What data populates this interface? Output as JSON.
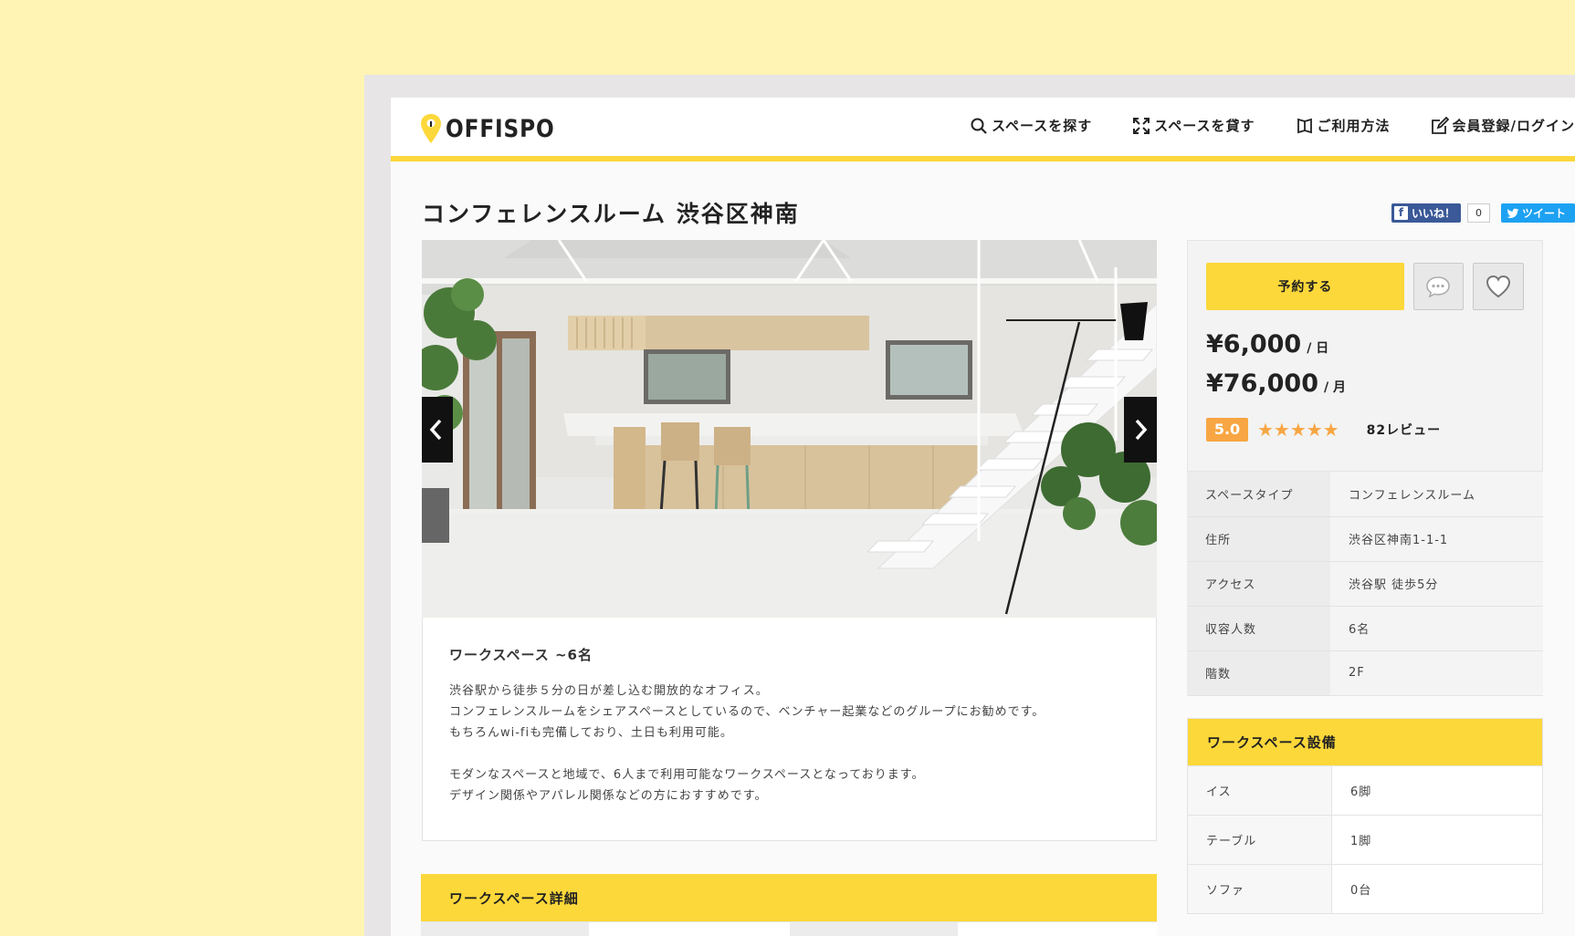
{
  "header": {
    "logo_text": "OFFISPO",
    "nav": [
      {
        "label": "スペースを探す",
        "icon": "search-icon"
      },
      {
        "label": "スペースを貸す",
        "icon": "expand-icon"
      },
      {
        "label": "ご利用方法",
        "icon": "book-icon"
      },
      {
        "label": "会員登録/ログイン",
        "icon": "edit-icon"
      }
    ]
  },
  "title": "コンフェレンスルーム 渋谷区神南",
  "social": {
    "fb_label": "いいね！",
    "fb_count": "0",
    "tweet_label": "ツイート"
  },
  "description": {
    "title": "ワークスペース ~6名",
    "lines1": [
      "渋谷駅から徒歩５分の日が差し込む開放的なオフィス。",
      "コンフェレンスルームをシェアスペースとしているので、ベンチャー起業などのグループにお勧めです。",
      "もちろんwi-fiも完備しており、土日も利用可能。"
    ],
    "lines2": [
      "モダンなスペースと地域で、6人まで利用可能なワークスペースとなっております。",
      "デザイン関係やアパレル関係などの方におすすめです。"
    ]
  },
  "detail_section_title": "ワークスペース詳細",
  "booking": {
    "reserve_label": "予約する",
    "price_day": "¥6,000",
    "price_day_unit": "/ 日",
    "price_month": "¥76,000",
    "price_month_unit": "/ 月",
    "score": "5.0",
    "stars": "★★★★★",
    "rating_value": 5,
    "reviews": "82レビュー"
  },
  "info": [
    {
      "key": "スペースタイプ",
      "value": "コンフェレンスルーム"
    },
    {
      "key": "住所",
      "value": "渋谷区神南1-1-1"
    },
    {
      "key": "アクセス",
      "value": "渋谷駅 徒歩5分"
    },
    {
      "key": "収容人数",
      "value": "6名"
    },
    {
      "key": "階数",
      "value": "2F"
    }
  ],
  "facility": {
    "title": "ワークスペース設備",
    "rows": [
      {
        "key": "イス",
        "value": "6脚"
      },
      {
        "key": "テーブル",
        "value": "1脚"
      },
      {
        "key": "ソファ",
        "value": "0台"
      }
    ]
  },
  "colors": {
    "background": "#fff4b3",
    "accent": "#fcd83a",
    "rating": "#f8a643",
    "facebook": "#3b5998",
    "twitter": "#1da1f2"
  }
}
